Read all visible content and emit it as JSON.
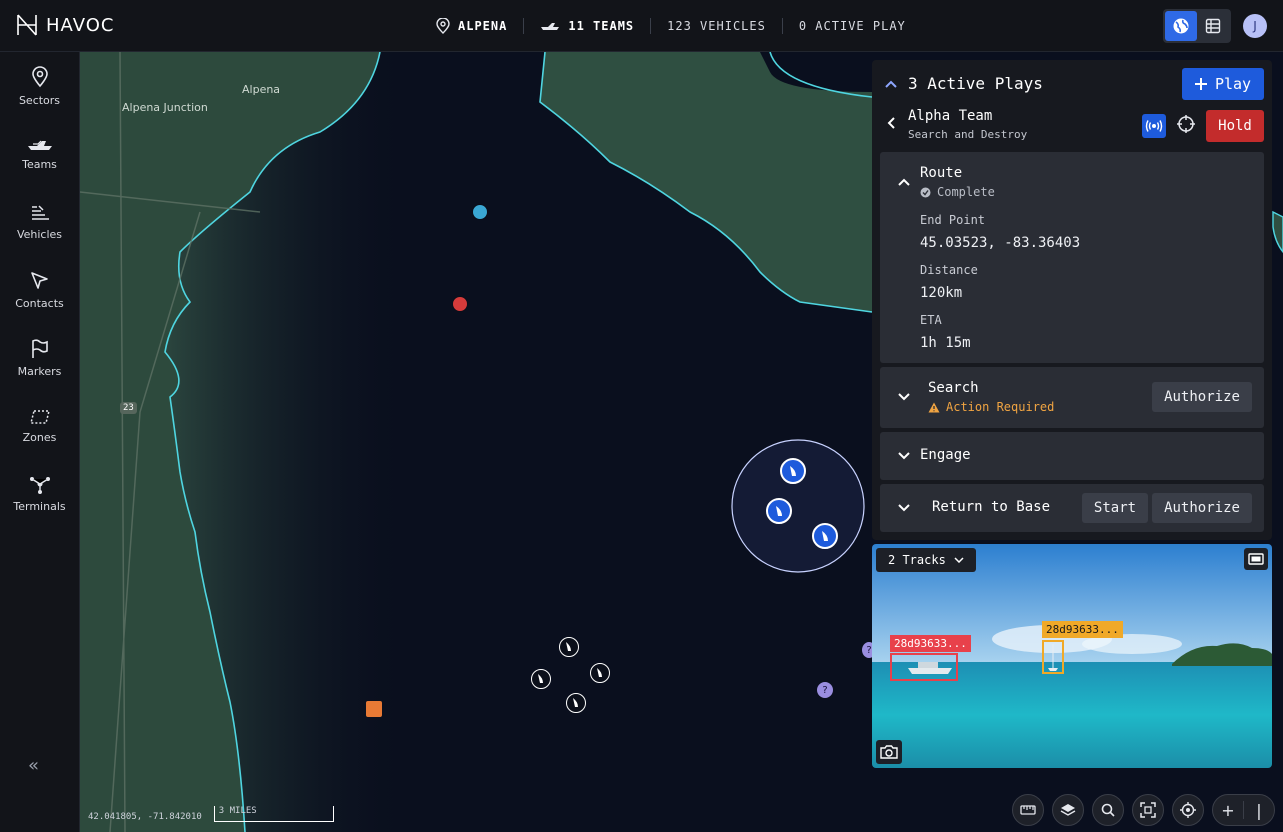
{
  "app": {
    "name": "HAVOC"
  },
  "topbar": {
    "location": "ALPENA",
    "teams": "11 TEAMS",
    "vehicles": "123 VEHICLES",
    "active_play": "0 ACTIVE PLAY",
    "user_initial": "J"
  },
  "sidebar": {
    "items": [
      {
        "label": "Sectors",
        "icon": "pin-icon"
      },
      {
        "label": "Teams",
        "icon": "boats-icon"
      },
      {
        "label": "Vehicles",
        "icon": "vehicles-icon"
      },
      {
        "label": "Contacts",
        "icon": "cursor-icon"
      },
      {
        "label": "Markers",
        "icon": "flag-icon"
      },
      {
        "label": "Zones",
        "icon": "zone-icon"
      },
      {
        "label": "Terminals",
        "icon": "network-icon"
      }
    ],
    "collapse": "«"
  },
  "map": {
    "labels": {
      "alpena_junction": "Alpena Junction",
      "alpena": "Alpena",
      "route_23": "23"
    },
    "coordinates": "42.041805, -71.842010",
    "scale": "3 MILES",
    "colors": {
      "water": "#0a0f1e",
      "shore": "#4fd5e0",
      "land": "#2d4a3d"
    }
  },
  "panel": {
    "active_plays": "3 Active Plays",
    "play_button": "Play",
    "team": {
      "name": "Alpha Team",
      "mission": "Search and Destroy",
      "hold": "Hold"
    },
    "route": {
      "title": "Route",
      "status": "Complete",
      "end_point_label": "End Point",
      "end_point": "45.03523, -83.36403",
      "distance_label": "Distance",
      "distance": "120km",
      "eta_label": "ETA",
      "eta": "1h 15m"
    },
    "search": {
      "title": "Search",
      "status": "Action Required",
      "authorize": "Authorize"
    },
    "engage": {
      "title": "Engage"
    },
    "rtb": {
      "title": "Return to Base",
      "start": "Start",
      "authorize": "Authorize"
    }
  },
  "video": {
    "tracks": "2 Tracks",
    "detections": [
      {
        "id": "28d93633...",
        "color": "#e8414b"
      },
      {
        "id": "28d93633...",
        "color": "#f0a928"
      }
    ]
  }
}
